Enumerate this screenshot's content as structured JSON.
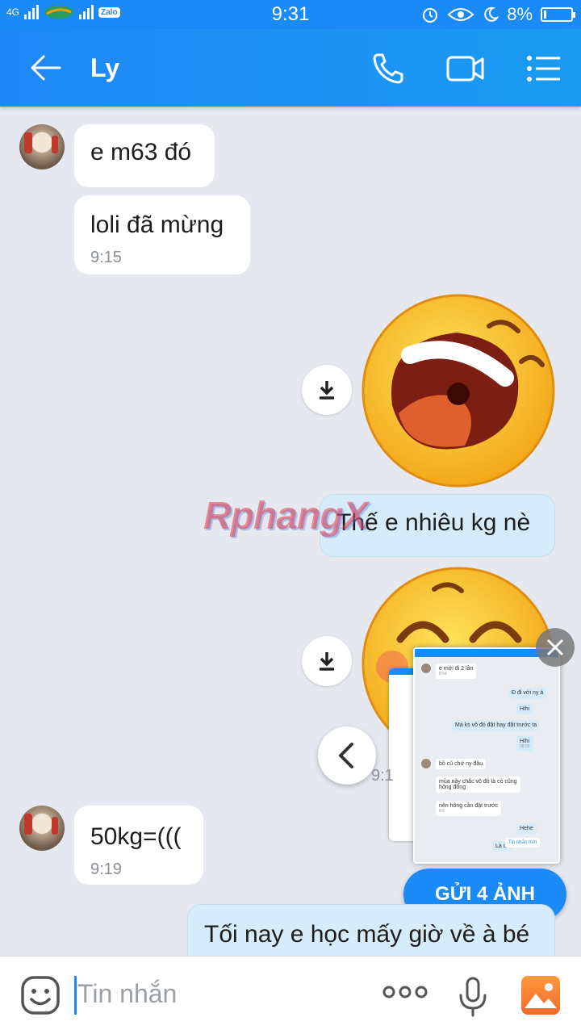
{
  "status": {
    "network": "4G",
    "zalo_badge": "Zalo",
    "time": "9:31",
    "battery": "8%"
  },
  "header": {
    "title": "Ly"
  },
  "messages": {
    "m1": "e m63 đó",
    "m2": "loli đã mừng",
    "m2_time": "9:15",
    "m3": "Thế e nhiêu kg nè",
    "m4": "50kg=(((",
    "m4_time": "9:19",
    "m5": "Tối nay e học mấy giờ về à bé",
    "partial_time": "9:1"
  },
  "watermark": "RphangX",
  "preview": {
    "p1": "e mới đi 2 lần",
    "p1_time": "8:54",
    "p2": "Đ đi với ny à",
    "p3": "Hihi",
    "p4": "Mà ks vô đó đặt hay đặt trước ta",
    "p5": "Hihi",
    "p5_time": "08:55",
    "p6": "bồ cũ chứ ny đâu",
    "p7a": "mùa này chắc vô đó là có cũng",
    "p7b": "hông đông",
    "p8": "nên hông cần đặt trước",
    "p8_time": "8:5",
    "p9": "Hehe",
    "p10": "Tin nhắn mới",
    "p11": "Là ch"
  },
  "send_button": "GỬI 4 ẢNH",
  "input": {
    "placeholder": "Tin nhắn"
  },
  "colors": {
    "brand": "#1a8bf6",
    "bubble_out": "#d7ecfb",
    "bubble_in": "#ffffff",
    "background": "#e5e9ef"
  }
}
